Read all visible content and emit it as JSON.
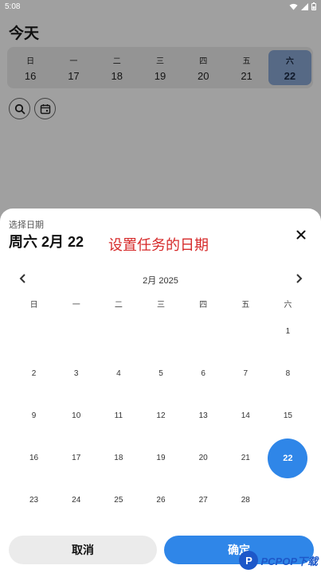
{
  "status_bar": {
    "time": "5:08"
  },
  "app": {
    "title": "今天",
    "week_strip": [
      {
        "weekday": "日",
        "day": "16"
      },
      {
        "weekday": "一",
        "day": "17"
      },
      {
        "weekday": "二",
        "day": "18"
      },
      {
        "weekday": "三",
        "day": "19"
      },
      {
        "weekday": "四",
        "day": "20"
      },
      {
        "weekday": "五",
        "day": "21"
      },
      {
        "weekday": "六",
        "day": "22",
        "selected": true
      }
    ],
    "tools": [
      "search-icon",
      "calendar-icon"
    ]
  },
  "date_picker": {
    "subtitle": "选择日期",
    "selected_date": "周六 2月 22",
    "annotation": "设置任务的日期",
    "month_label": "2月 2025",
    "weekday_headers": [
      "日",
      "一",
      "二",
      "三",
      "四",
      "五",
      "六"
    ],
    "weeks": [
      [
        "",
        "",
        "",
        "",
        "",
        "",
        "1"
      ],
      [
        "2",
        "3",
        "4",
        "5",
        "6",
        "7",
        "8"
      ],
      [
        "9",
        "10",
        "11",
        "12",
        "13",
        "14",
        "15"
      ],
      [
        "16",
        "17",
        "18",
        "19",
        "20",
        "21",
        "22"
      ],
      [
        "23",
        "24",
        "25",
        "26",
        "27",
        "28",
        ""
      ]
    ],
    "selected_day": "22",
    "cancel_label": "取消",
    "confirm_label": "确定"
  },
  "watermark": {
    "text": "PCPOP下载",
    "logo_letter": "P"
  },
  "colors": {
    "accent": "#2f86e8",
    "annotation": "#d62a2a",
    "week_selected": "#87a5d0"
  }
}
